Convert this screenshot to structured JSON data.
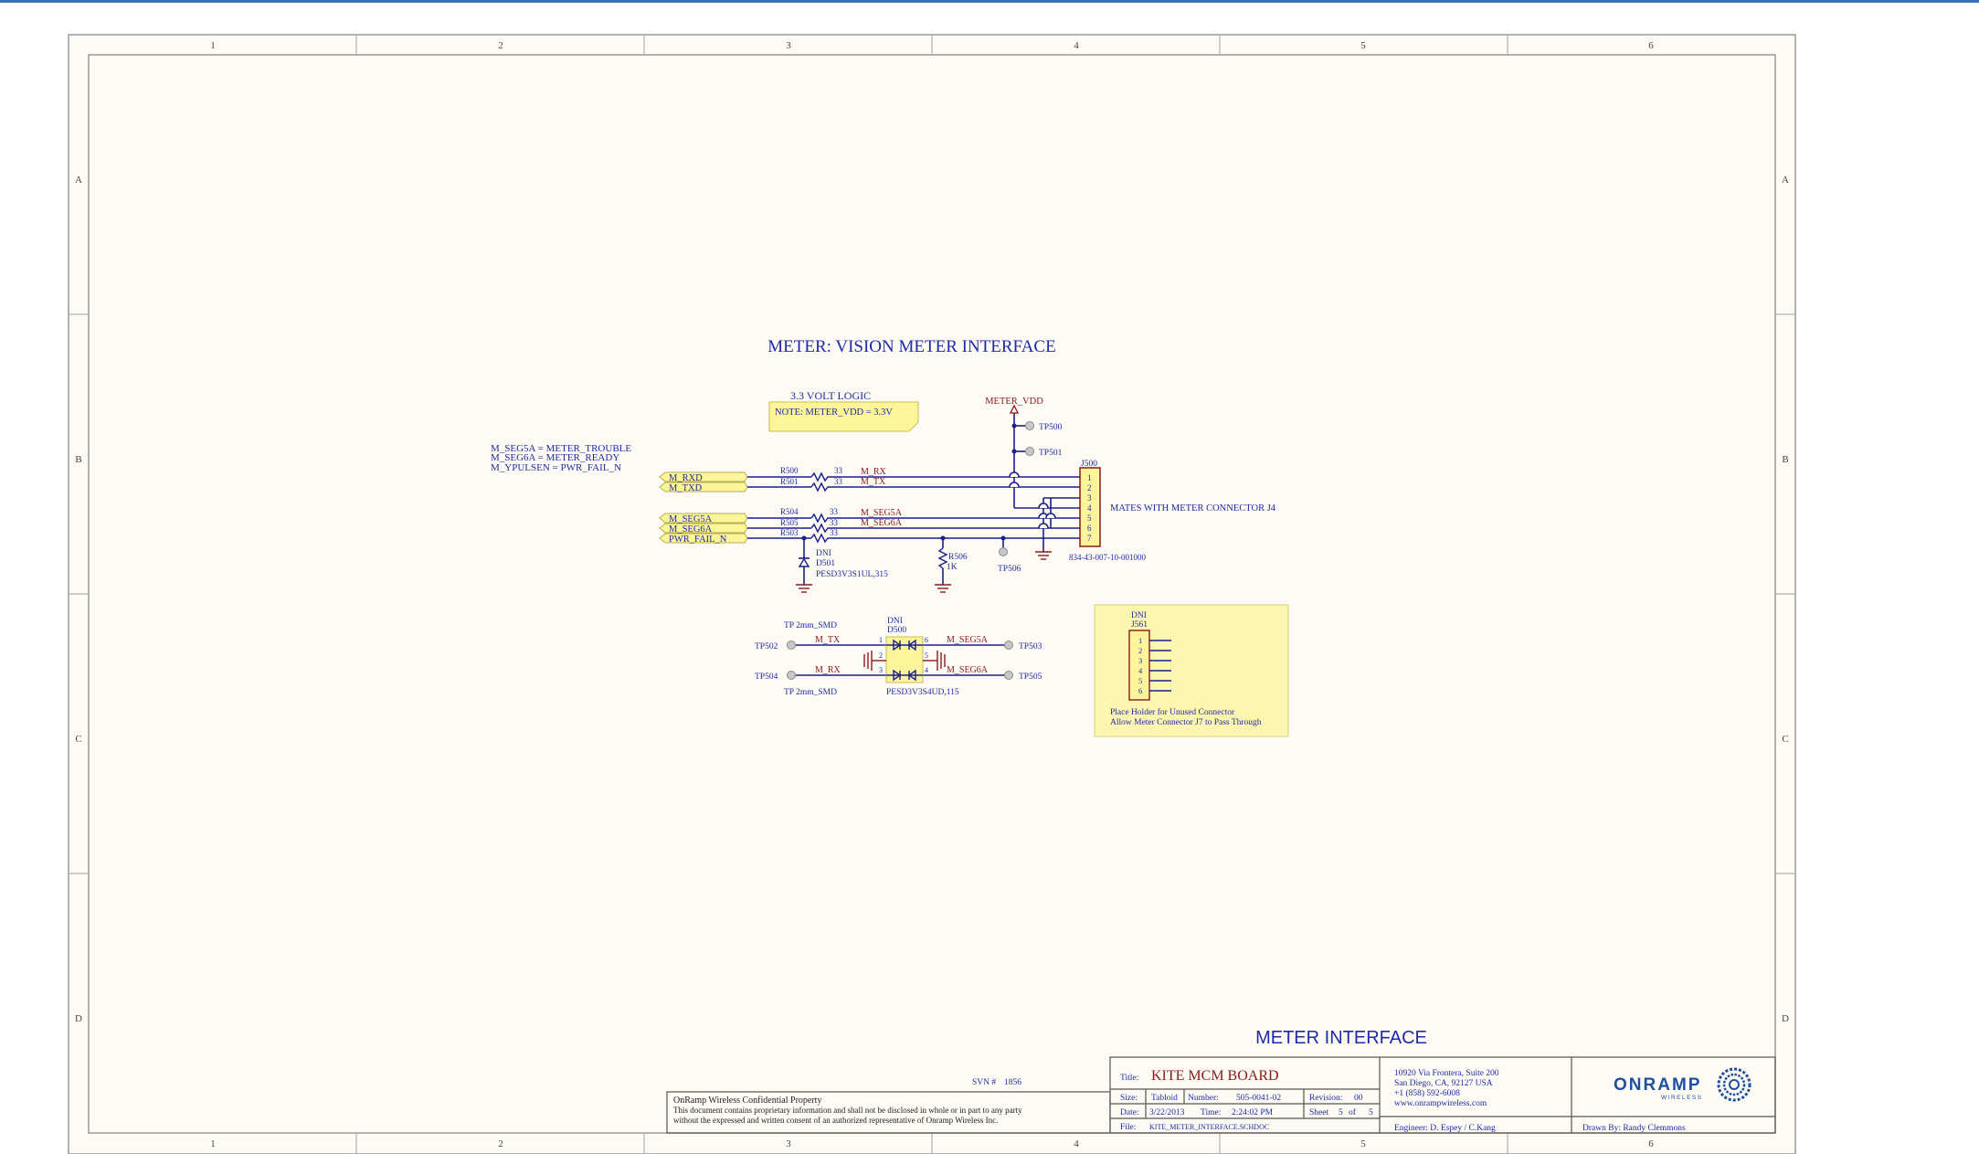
{
  "frame": {
    "columns": [
      "1",
      "2",
      "3",
      "4",
      "5",
      "6"
    ],
    "rows": [
      "A",
      "B",
      "C",
      "D"
    ]
  },
  "schematic": {
    "title": "METER: VISION METER INTERFACE",
    "logic_note_heading": "3.3 VOLT LOGIC",
    "logic_note_text": "NOTE: METER_VDD = 3.3V",
    "legend": [
      "M_SEG5A = METER_TROUBLE",
      "M_SEG6A = METER_READY",
      "M_YPULSEN = PWR_FAIL_N"
    ],
    "ports": [
      "M_RXD",
      "M_TXD",
      "M_SEG5A",
      "M_SEG6A",
      "PWR_FAIL_N"
    ],
    "resistors": [
      {
        "ref": "R500",
        "value": "33",
        "net": "M_RX"
      },
      {
        "ref": "R501",
        "value": "33",
        "net": "M_TX"
      },
      {
        "ref": "R504",
        "value": "33",
        "net": "M_SEG5A"
      },
      {
        "ref": "R505",
        "value": "33",
        "net": "M_SEG6A"
      },
      {
        "ref": "R503",
        "value": "33",
        "net": ""
      }
    ],
    "power_net": "METER_VDD",
    "testpoints_vdd": [
      "TP500",
      "TP501"
    ],
    "connector": {
      "ref": "J500",
      "pins": [
        "1",
        "2",
        "3",
        "4",
        "5",
        "6",
        "7"
      ],
      "part": "834-43-007-10-001000",
      "note": "MATES WITH METER CONNECTOR J4"
    },
    "d501": {
      "dni": "DNI",
      "ref": "D501",
      "part": "PESD3V3S1UL,315"
    },
    "r506": {
      "ref": "R506",
      "value": "1K"
    },
    "tp506": "TP506",
    "d500": {
      "dni": "DNI",
      "ref": "D500",
      "part": "PESD3V3S4UD,115",
      "pins": [
        "1",
        "2",
        "3",
        "4",
        "5",
        "6"
      ]
    },
    "esd_testpoints": {
      "tp502": "TP502",
      "tp504": "TP504",
      "tp503": "TP503",
      "tp505": "TP505",
      "smd_top": "TP 2mm_SMD",
      "smd_bottom": "TP 2mm_SMD",
      "net_tx": "M_TX",
      "net_rx": "M_RX",
      "net_seg5a": "M_SEG5A",
      "net_seg6a": "M_SEG6A"
    },
    "j561": {
      "dni": "DNI",
      "ref": "J561",
      "pins": [
        "1",
        "2",
        "3",
        "4",
        "5",
        "6"
      ],
      "note1": "Place Holder for Unused Connector",
      "note2": "Allow Meter Connector J7 to Pass Through"
    }
  },
  "title_block": {
    "heading": "METER INTERFACE",
    "svn_label": "SVN #",
    "svn_value": "1856",
    "conf_title": "OnRamp Wireless Confidential Property",
    "conf_line1": "This document contains proprietary information and shall not be disclosed in whole or in part to any party",
    "conf_line2": "without the expressed and written consent of an authorized representative of Onramp Wireless Inc.",
    "title_label": "Title:",
    "title_value": "KITE MCM BOARD",
    "size_label": "Size:",
    "size_value": "Tabloid",
    "number_label": "Number:",
    "number_value": "505-0041-02",
    "revision_label": "Revision:",
    "revision_value": "00",
    "date_label": "Date:",
    "date_value": "3/22/2013",
    "time_label": "Time:",
    "time_value": "2:24:02 PM",
    "sheet_label": "Sheet",
    "sheet_value": "5",
    "of_label": "of",
    "sheet_total": "5",
    "file_label": "File:",
    "file_value": "KITE_METER_INTERFACE.SCHDOC",
    "address1": "10920 Via Frontera, Suite 200",
    "address2": "San Diego, CA, 92127 USA",
    "phone": "+1 (858) 592-6008",
    "web": "www.onrampwireless.com",
    "engineer": "Engineer:  D. Espey / C.Kang",
    "drawn_by": "Drawn By:  Randy Clemmons",
    "logo_text": "ONRAMP",
    "logo_sub": "WIRELESS"
  },
  "colors": {
    "paper": "#fdfbf4",
    "border": "#7d7d7d",
    "wire": "#1a1f8c",
    "text_blue": "#1e2aa8",
    "net_red": "#8b1a1a",
    "note_yellow": "#fdf59a",
    "j561_bg": "#fdf6b0",
    "logo": "#1d4fa0"
  }
}
